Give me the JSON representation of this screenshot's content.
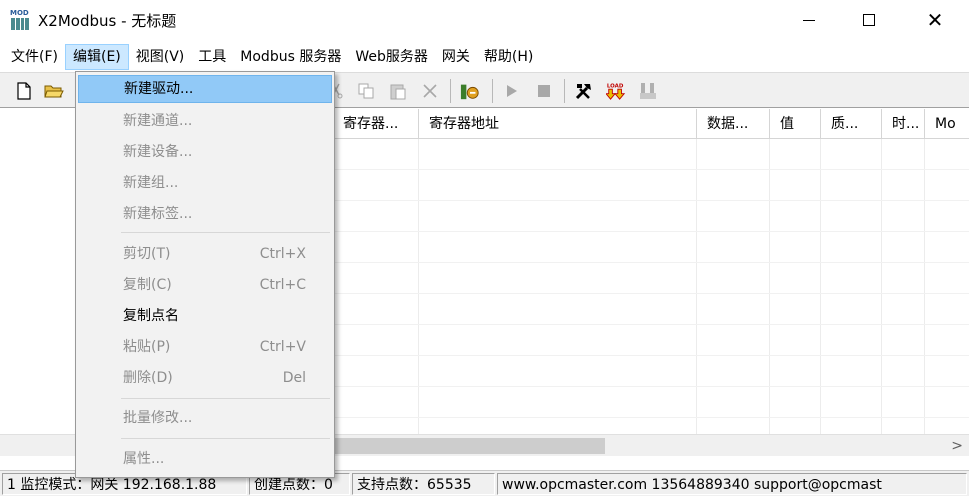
{
  "window": {
    "title": "X2Modbus - 无标题",
    "icon_badge": "MOD"
  },
  "menubar": {
    "items": [
      "文件(F)",
      "编辑(E)",
      "视图(V)",
      "工具",
      "Modbus 服务器",
      "Web服务器",
      "网关",
      "帮助(H)"
    ],
    "active_index": 1
  },
  "edit_menu": {
    "items": [
      {
        "label": "新建驱动...",
        "shortcut": "",
        "state": "hover"
      },
      {
        "label": "新建通道...",
        "shortcut": "",
        "state": "disabled"
      },
      {
        "label": "新建设备...",
        "shortcut": "",
        "state": "disabled"
      },
      {
        "label": "新建组...",
        "shortcut": "",
        "state": "disabled"
      },
      {
        "label": "新建标签...",
        "shortcut": "",
        "state": "disabled"
      },
      {
        "label": "剪切(T)",
        "shortcut": "Ctrl+X",
        "state": "disabled"
      },
      {
        "label": "复制(C)",
        "shortcut": "Ctrl+C",
        "state": "disabled"
      },
      {
        "label": "复制点名",
        "shortcut": "",
        "state": "enabled"
      },
      {
        "label": "粘贴(P)",
        "shortcut": "Ctrl+V",
        "state": "disabled"
      },
      {
        "label": "删除(D)",
        "shortcut": "Del",
        "state": "disabled"
      },
      {
        "label": "批量修改...",
        "shortcut": "",
        "state": "disabled"
      },
      {
        "label": "属性...",
        "shortcut": "",
        "state": "disabled"
      }
    ]
  },
  "toolbar": {
    "icons": [
      "new-file-icon",
      "open-folder-icon",
      "cut-icon",
      "copy-icon",
      "paste-icon",
      "delete-icon",
      "tag-icon",
      "run-icon",
      "stop-icon",
      "tools-icon",
      "load-icon",
      "unload-icon"
    ],
    "load_text": "LOAD"
  },
  "tag_list": {
    "columns": [
      "寄存器...",
      "寄存器地址",
      "数据...",
      "值",
      "质...",
      "时...",
      "Mo"
    ]
  },
  "statusbar": {
    "monitor_mode": "1 监控模式：网关 192.168.1.88",
    "created_points": "创建点数：0",
    "supported_points": "支持点数：65535",
    "contact": "www.opcmaster.com 13564889340 support@opcmast"
  },
  "colors": {
    "menu_hover": "#91c9f7",
    "menubar_active": "#cce8ff",
    "disabled_text": "#8e8e8e"
  }
}
